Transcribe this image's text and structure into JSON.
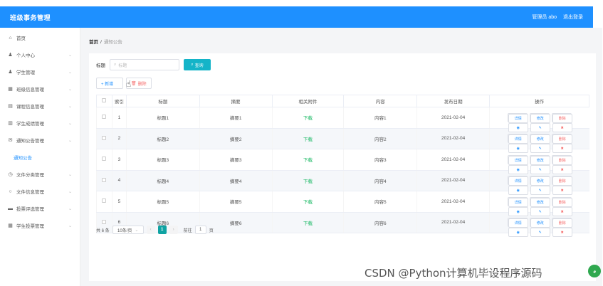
{
  "header": {
    "title": "班级事务管理",
    "user_label": "管理员 abo",
    "logout_label": "退出登录"
  },
  "sidebar": {
    "items": [
      {
        "label": "首页",
        "icon": "home-icon",
        "glyph": "⌂",
        "has_chevron": false
      },
      {
        "label": "个人中心",
        "icon": "user-icon",
        "glyph": "♟",
        "has_chevron": true
      },
      {
        "label": "学生管理",
        "icon": "user-icon",
        "glyph": "♟",
        "has_chevron": true
      },
      {
        "label": "班级信息管理",
        "icon": "grid-icon",
        "glyph": "▦",
        "has_chevron": true
      },
      {
        "label": "课程信息管理",
        "icon": "list-icon",
        "glyph": "▤",
        "has_chevron": true
      },
      {
        "label": "学生成绩管理",
        "icon": "chart-icon",
        "glyph": "▥",
        "has_chevron": true
      },
      {
        "label": "通知公告管理",
        "icon": "mail-icon",
        "glyph": "✉",
        "has_chevron": true
      },
      {
        "label": "通知公告",
        "icon": "",
        "glyph": "",
        "has_chevron": false,
        "sub": true
      },
      {
        "label": "文件分类管理",
        "icon": "clock-icon",
        "glyph": "◷",
        "has_chevron": true
      },
      {
        "label": "文件信息管理",
        "icon": "circle-icon",
        "glyph": "○",
        "has_chevron": true
      },
      {
        "label": "投票评选管理",
        "icon": "folder-icon",
        "glyph": "▬",
        "has_chevron": true
      },
      {
        "label": "学生投票管理",
        "icon": "table-icon",
        "glyph": "▦",
        "has_chevron": true
      }
    ]
  },
  "breadcrumb": {
    "home": "首页",
    "sep": "/",
    "current": "通知公告"
  },
  "search": {
    "label": "标题",
    "placeholder": "标题",
    "button_label": "查询"
  },
  "actions": {
    "add_label": "+ 新增",
    "delete_label": "删除"
  },
  "table": {
    "columns": [
      "索引",
      "标题",
      "摘要",
      "相关附件",
      "内容",
      "发布日期",
      "操作"
    ],
    "rows": [
      {
        "index": "1",
        "title": "标题1",
        "summary": "摘要1",
        "attachment": "下载",
        "content": "内容1",
        "date": "2021-02-04"
      },
      {
        "index": "2",
        "title": "标题2",
        "summary": "摘要2",
        "attachment": "下载",
        "content": "内容2",
        "date": "2021-02-04"
      },
      {
        "index": "3",
        "title": "标题3",
        "summary": "摘要3",
        "attachment": "下载",
        "content": "内容3",
        "date": "2021-02-04"
      },
      {
        "index": "4",
        "title": "标题4",
        "summary": "摘要4",
        "attachment": "下载",
        "content": "内容4",
        "date": "2021-02-04"
      },
      {
        "index": "5",
        "title": "标题5",
        "summary": "摘要5",
        "attachment": "下载",
        "content": "内容5",
        "date": "2021-02-04"
      },
      {
        "index": "6",
        "title": "标题6",
        "summary": "摘要6",
        "attachment": "下载",
        "content": "内容6",
        "date": "2021-02-04"
      }
    ],
    "op_view": "详情",
    "op_edit": "修改",
    "op_delete": "删除"
  },
  "pagination": {
    "total": "共 6 条",
    "page_size": "10条/页",
    "current_page": "1",
    "goto_label": "前往",
    "goto_value": "1",
    "page_suffix": "页"
  },
  "watermark": {
    "text": "CSDN @Python计算机毕设程序源码"
  },
  "colors": {
    "header_bg": "#1e90ff",
    "search_btn": "#14b4c8",
    "download": "#13b75f",
    "delete": "#f56c6c",
    "page_active": "#0fa3a3"
  }
}
